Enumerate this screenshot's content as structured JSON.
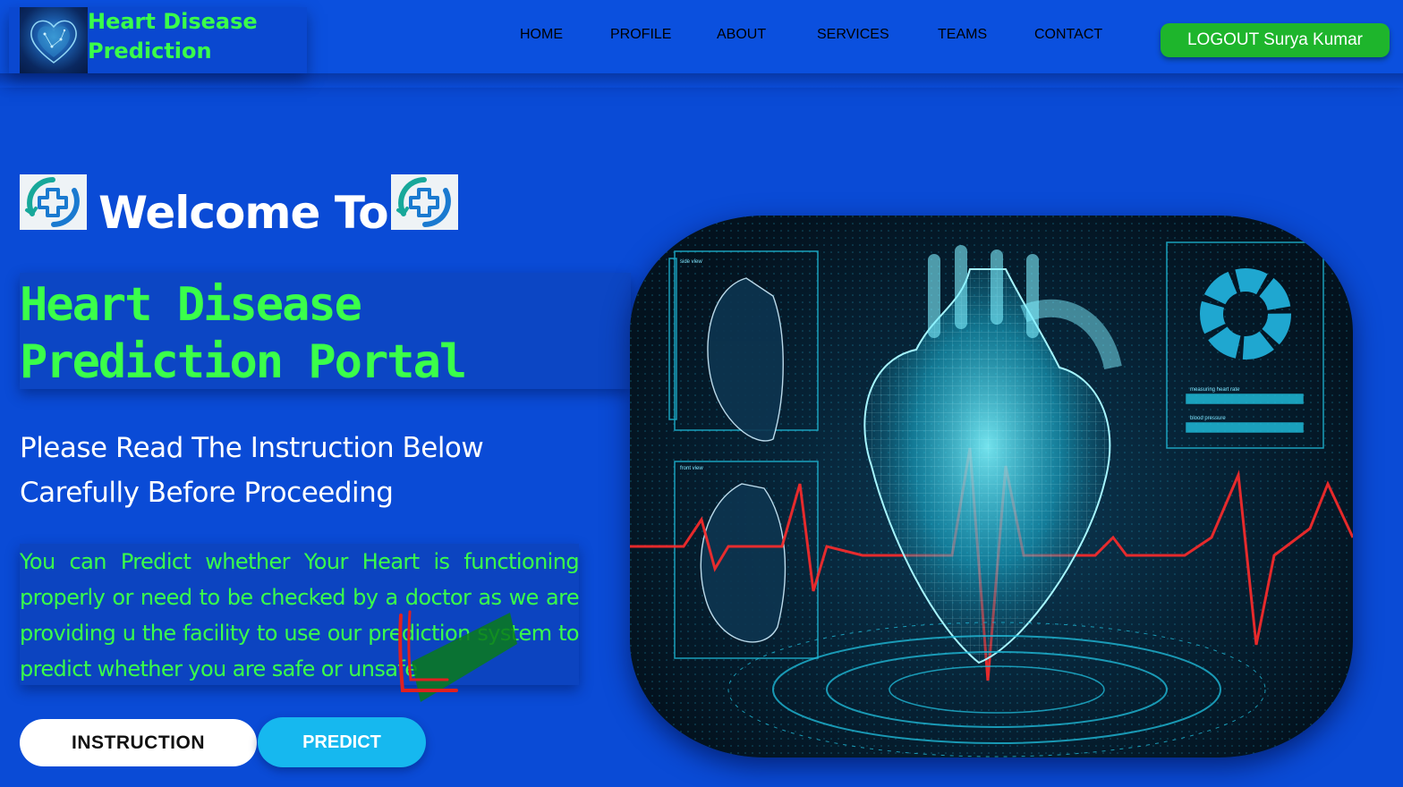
{
  "header": {
    "brand_title": "Heart Disease Prediction",
    "nav": [
      "HOME",
      "PROFILE",
      "ABOUT",
      "SERVICES",
      "TEAMS",
      "CONTACT"
    ],
    "logout_label": "LOGOUT Surya Kumar"
  },
  "main": {
    "welcome": "Welcome To",
    "portal_title": "Heart Disease Prediction Portal",
    "instruction_heading": "Please Read The Instruction Below Carefully Before Proceeding",
    "description": "You can Predict whether Your Heart is functioning properly or need to be checked by a doctor as we are providing u the facility to use our prediction system to predict whether you are safe or unsafe",
    "buttons": {
      "instruction": "INSTRUCTION",
      "predict": "PREDICT"
    }
  },
  "colors": {
    "background": "#0a4bd6",
    "accent_green": "#3aff4a",
    "logout_green": "#1eb52c",
    "predict_blue": "#16b8ef"
  },
  "icons": {
    "brand_logo": "heart-logo-icon",
    "welcome_icons": [
      "medical-cross-icon",
      "medical-cross-icon"
    ],
    "hero_image": "holographic-heart-image"
  },
  "hero_labels": {
    "side_view": "side view",
    "front_view": "front view",
    "measuring": "measuring heart rate",
    "blood_pressure": "blood pressure"
  }
}
